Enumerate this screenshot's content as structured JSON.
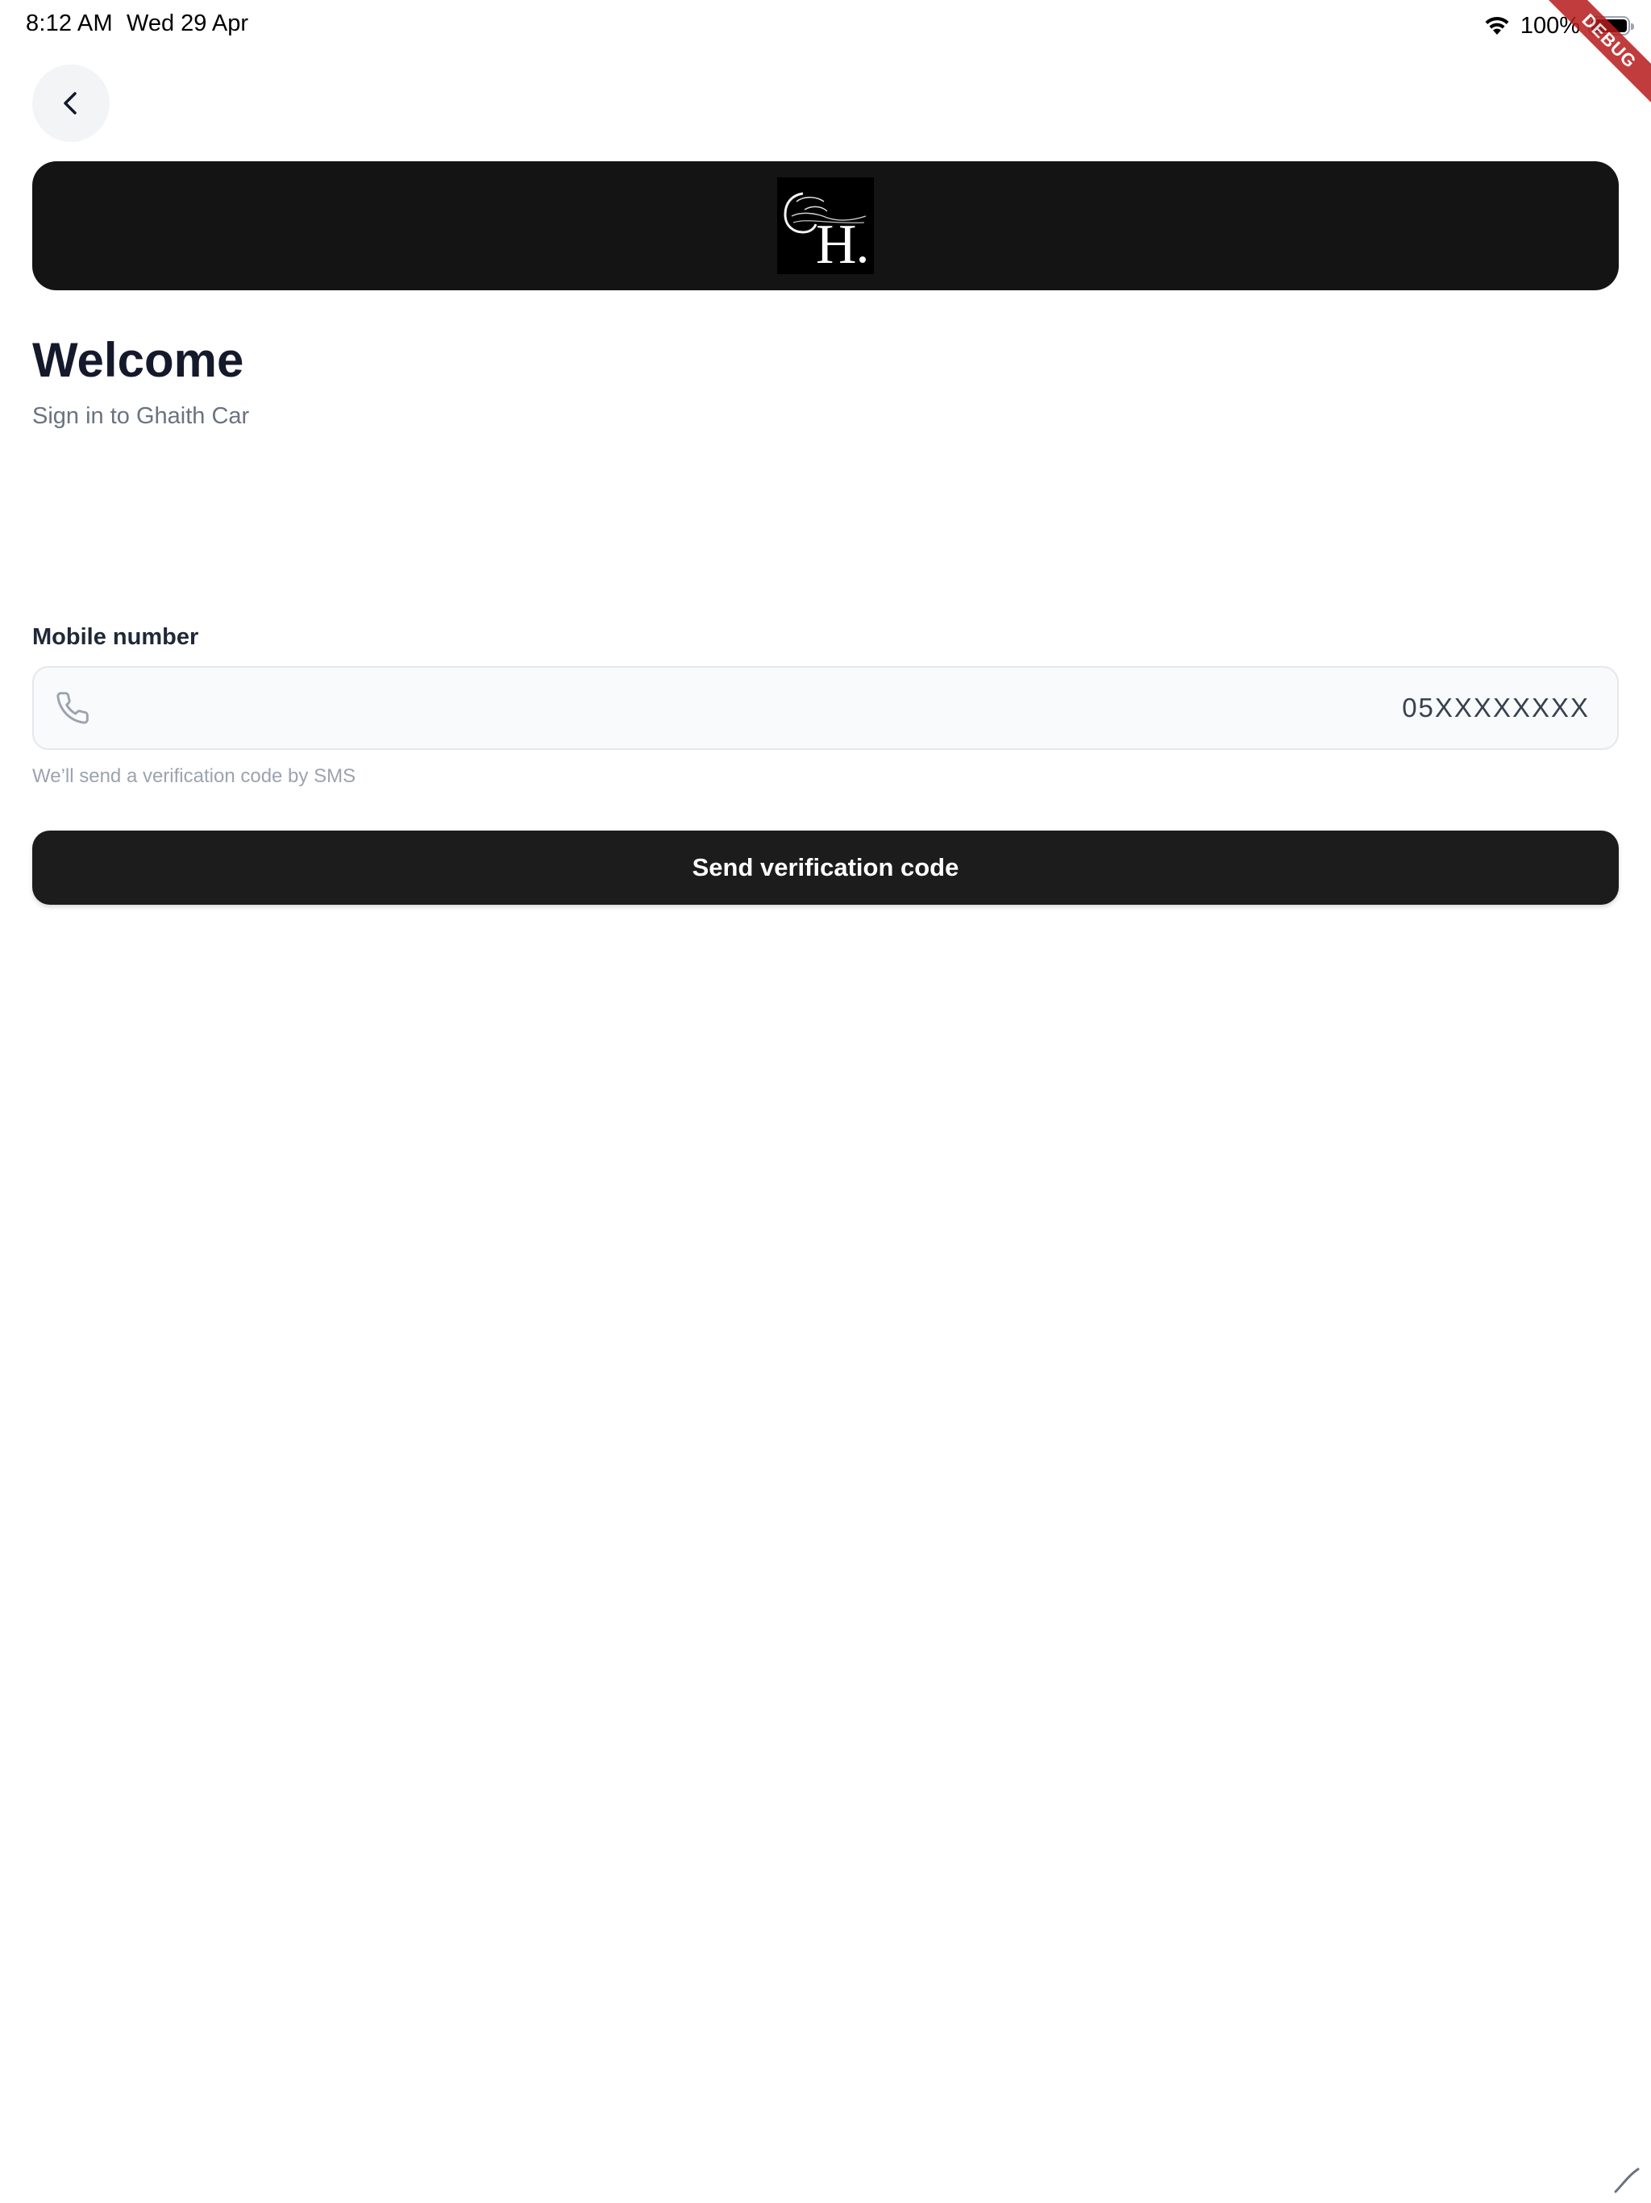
{
  "status_bar": {
    "time": "8:12 AM",
    "date": "Wed 29 Apr",
    "battery_percent": "100%",
    "icons": [
      "wifi-icon",
      "battery-icon"
    ]
  },
  "debug_banner": {
    "label": "DEBUG"
  },
  "header": {
    "back_icon": "chevron-left-icon"
  },
  "brand": {
    "logo_text": "GH.",
    "banner_color": "#141414"
  },
  "welcome": {
    "title": "Welcome",
    "subtitle": "Sign in to Ghaith Car"
  },
  "form": {
    "mobile_label": "Mobile number",
    "mobile_placeholder": "05XXXXXXXX",
    "mobile_icon": "phone-icon",
    "helper_text": "We’ll send a verification code by SMS",
    "submit_label": "Send verification code"
  },
  "colors": {
    "accent": "#1c1c1c",
    "title": "#141a2b",
    "muted": "#6b7280",
    "debug": "#b71c1c"
  }
}
